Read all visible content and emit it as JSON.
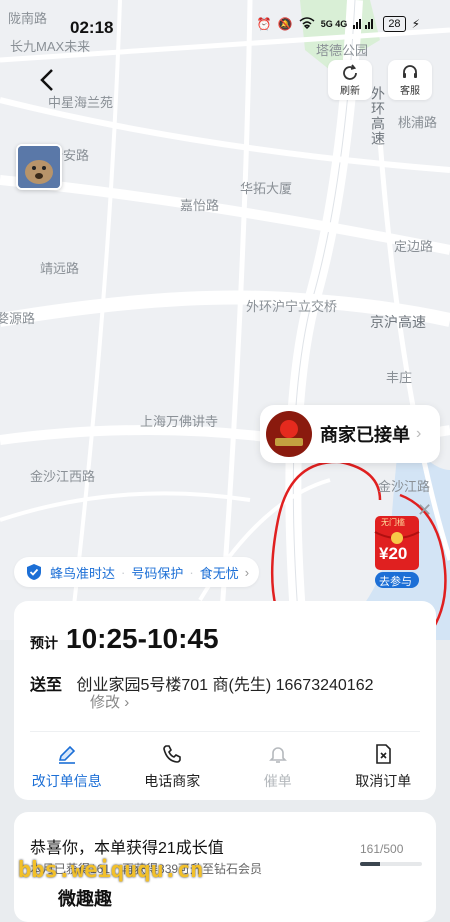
{
  "status_bar": {
    "time": "02:18",
    "battery": "28",
    "network": "5G 4G"
  },
  "map_labels": {
    "l1": "陇南路",
    "l2": "长九MAX未来",
    "l3": "中星海兰苑",
    "l4": "塔德公园",
    "l5": "外环高速",
    "l6": "桃浦路",
    "l7": "华拓大厦",
    "l8": "嘉怡路",
    "l9": "定边路",
    "l10": "靖远路",
    "l11": "外环沪宁立交桥",
    "l12": "京沪高速",
    "l13": "丰庄",
    "l14": "上海万佛讲寺",
    "l15": "金沙江西路",
    "l16": "金沙江路",
    "l17": "婺源路",
    "l18": "新安路"
  },
  "top_buttons": {
    "refresh": "刷新",
    "service": "客服"
  },
  "merchant": {
    "status": "商家已接单"
  },
  "red_envelope": {
    "amount": "¥20",
    "cta": "去参与",
    "tag": "无门槛"
  },
  "guarantees": {
    "items": [
      "蜂鸟准时达",
      "号码保护",
      "食无忧"
    ]
  },
  "order": {
    "eta_label": "预计",
    "eta_time": "10:25-10:45",
    "address_label": "送至",
    "address": "创业家园5号楼701 商(先生) 16673240162",
    "edit": "修改"
  },
  "actions": [
    {
      "label": "改订单信息"
    },
    {
      "label": "电话商家"
    },
    {
      "label": "催单"
    },
    {
      "label": "取消订单"
    }
  ],
  "growth": {
    "title": "恭喜你，本单获得21成长值",
    "subtitle": "本月已获得161，再获得339可升至钻石会员",
    "progress_text": "161/500",
    "progress_fraction": 0.322
  },
  "watermark": {
    "site": "bbs.weiququ.cn",
    "name": "微趣趣"
  },
  "colors": {
    "accent": "#1c6fd6",
    "red": "#e02020",
    "map_bg": "#eef0f3"
  }
}
